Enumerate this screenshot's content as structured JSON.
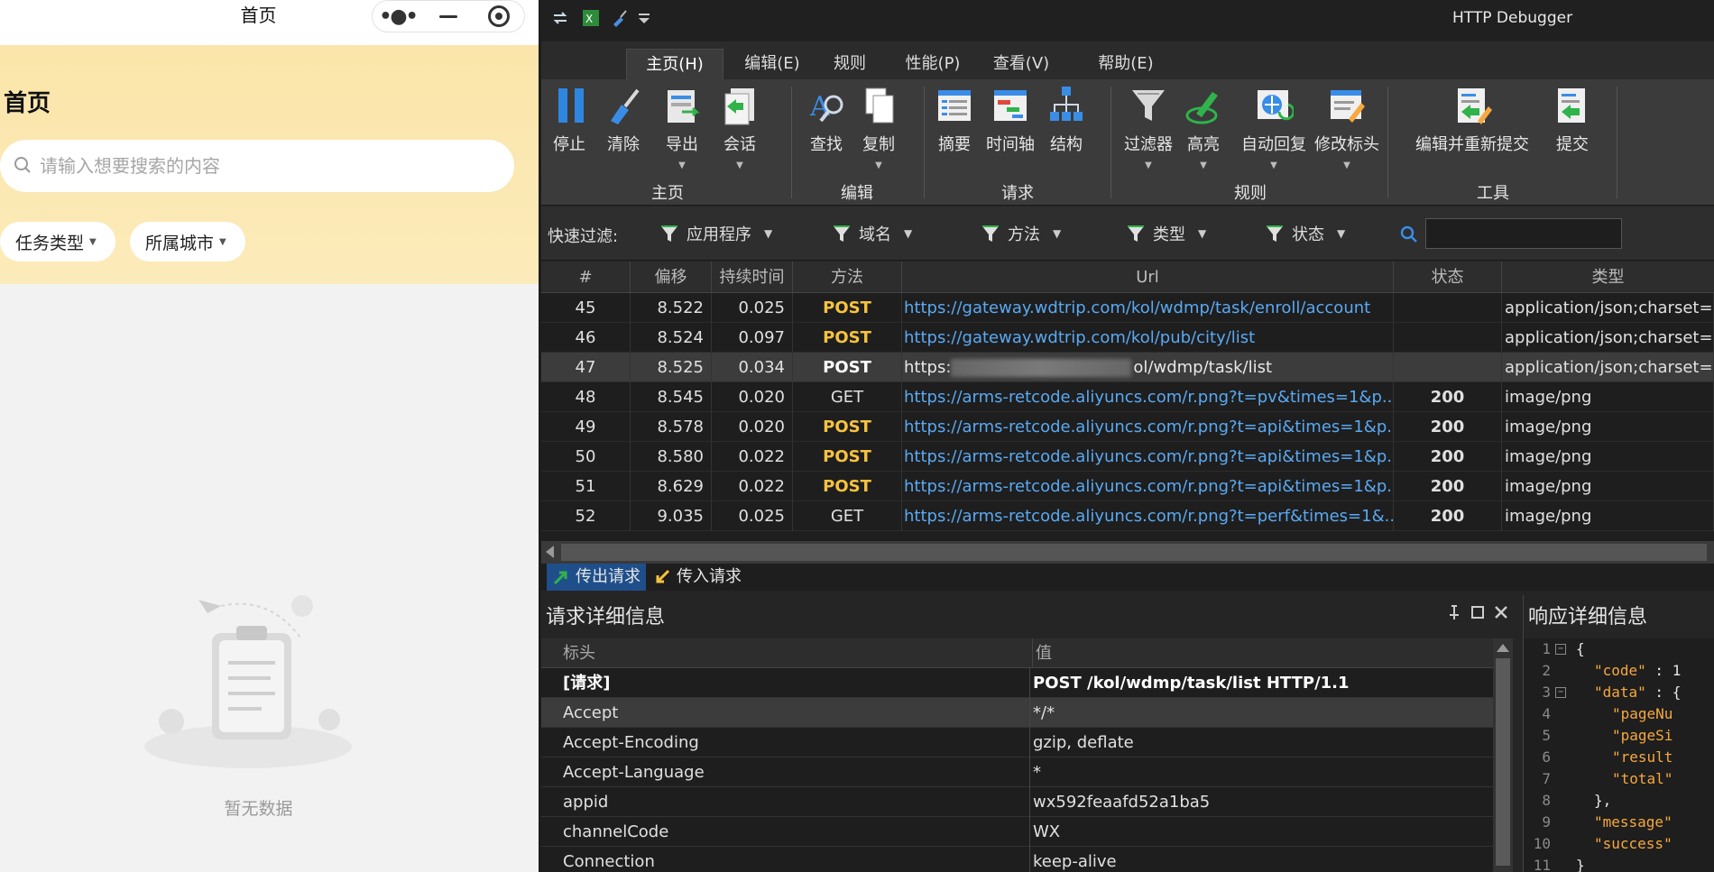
{
  "mini_program": {
    "nav_title": "首页",
    "page_title": "首页",
    "search": {
      "placeholder": "请输入想要搜索的内容"
    },
    "filters": [
      {
        "label": "任务类型"
      },
      {
        "label": "所属城市"
      }
    ],
    "empty_text": "暂无数据",
    "colors": {
      "header_gradient": "#fbe4a6",
      "background": "#f2f2f2"
    }
  },
  "debugger": {
    "window_title": "HTTP Debugger",
    "menu_tabs": [
      {
        "label": "主页(H)",
        "active": true
      },
      {
        "label": "编辑(E)"
      },
      {
        "label": "规则"
      },
      {
        "label": "性能(P)"
      },
      {
        "label": "查看(V)"
      },
      {
        "label": "帮助(E)"
      }
    ],
    "ribbon": {
      "buttons": [
        {
          "label": "停止",
          "icon": "pause-icon"
        },
        {
          "label": "清除",
          "icon": "broom-icon"
        },
        {
          "label": "导出",
          "icon": "export-icon",
          "dropdown": true
        },
        {
          "label": "会话",
          "icon": "session-icon",
          "dropdown": true
        },
        {
          "label": "查找",
          "icon": "find-icon"
        },
        {
          "label": "复制",
          "icon": "copy-icon",
          "dropdown": true
        },
        {
          "label": "摘要",
          "icon": "summary-icon"
        },
        {
          "label": "时间轴",
          "icon": "timeline-icon"
        },
        {
          "label": "结构",
          "icon": "structure-icon"
        },
        {
          "label": "过滤器",
          "icon": "filter-icon",
          "dropdown": true
        },
        {
          "label": "高亮",
          "icon": "highlight-icon",
          "dropdown": true
        },
        {
          "label": "自动回复",
          "icon": "auto-reply-icon",
          "dropdown": true
        },
        {
          "label": "修改标头",
          "icon": "modify-header-icon",
          "dropdown": true
        },
        {
          "label": "编辑并重新提交",
          "icon": "edit-resubmit-icon"
        },
        {
          "label": "提交",
          "icon": "submit-icon"
        }
      ],
      "groups": [
        "主页",
        "编辑",
        "请求",
        "规则",
        "工具"
      ]
    },
    "quick_filter": {
      "label": "快速过滤:",
      "items": [
        "应用程序",
        "域名",
        "方法",
        "类型",
        "状态"
      ]
    },
    "grid": {
      "columns": [
        "#",
        "偏移",
        "持续时间",
        "方法",
        "Url",
        "状态",
        "类型"
      ],
      "rows": [
        {
          "num": "45",
          "offset": "8.522",
          "duration": "0.025",
          "method": "POST",
          "url": "https://gateway.wdtrip.com/kol/wdmp/task/enroll/account",
          "status": "",
          "type": "application/json;charset=..."
        },
        {
          "num": "46",
          "offset": "8.524",
          "duration": "0.097",
          "method": "POST",
          "url": "https://gateway.wdtrip.com/kol/pub/city/list",
          "status": "",
          "type": "application/json;charset=..."
        },
        {
          "num": "47",
          "offset": "8.525",
          "duration": "0.034",
          "method": "POST",
          "url_prefix": "https:",
          "url_suffix": "ol/wdmp/task/list",
          "status": "",
          "type": "application/json;charset=..."
        },
        {
          "num": "48",
          "offset": "8.545",
          "duration": "0.020",
          "method": "GET",
          "url": "https://arms-retcode.aliyuncs.com/r.png?t=pv&times=1&p...",
          "status": "200",
          "type": "image/png"
        },
        {
          "num": "49",
          "offset": "8.578",
          "duration": "0.020",
          "method": "POST",
          "url": "https://arms-retcode.aliyuncs.com/r.png?t=api&times=1&p...",
          "status": "200",
          "type": "image/png"
        },
        {
          "num": "50",
          "offset": "8.580",
          "duration": "0.022",
          "method": "POST",
          "url": "https://arms-retcode.aliyuncs.com/r.png?t=api&times=1&p...",
          "status": "200",
          "type": "image/png"
        },
        {
          "num": "51",
          "offset": "8.629",
          "duration": "0.022",
          "method": "POST",
          "url": "https://arms-retcode.aliyuncs.com/r.png?t=api&times=1&p...",
          "status": "200",
          "type": "image/png"
        },
        {
          "num": "52",
          "offset": "9.035",
          "duration": "0.025",
          "method": "GET",
          "url": "https://arms-retcode.aliyuncs.com/r.png?t=perf&times=1&...",
          "status": "200",
          "type": "image/png"
        }
      ]
    },
    "direction_tabs": [
      {
        "label": "传出请求",
        "active": true
      },
      {
        "label": "传入请求"
      }
    ],
    "request_details": {
      "title": "请求详细信息",
      "columns": [
        "标头",
        "值"
      ],
      "rows": [
        {
          "key": "[请求]",
          "value": "POST /kol/wdmp/task/list HTTP/1.1"
        },
        {
          "key": "Accept",
          "value": "*/*"
        },
        {
          "key": "Accept-Encoding",
          "value": "gzip, deflate"
        },
        {
          "key": "Accept-Language",
          "value": "*"
        },
        {
          "key": "appid",
          "value": "wx592feaafd52a1ba5"
        },
        {
          "key": "channelCode",
          "value": "WX"
        },
        {
          "key": "Connection",
          "value": "keep-alive"
        }
      ]
    },
    "response_details": {
      "title": "响应详细信息",
      "lines": [
        {
          "n": "1",
          "text": "{"
        },
        {
          "n": "2",
          "key": "\"code\"",
          "rest": " : 1"
        },
        {
          "n": "3",
          "key": "\"data\"",
          "rest": " : {"
        },
        {
          "n": "4",
          "key": "\"pageNu",
          "rest": ""
        },
        {
          "n": "5",
          "key": "\"pageSi",
          "rest": ""
        },
        {
          "n": "6",
          "key": "\"result",
          "rest": ""
        },
        {
          "n": "7",
          "key": "\"total\"",
          "rest": ""
        },
        {
          "n": "8",
          "text": "},",
          "indent": true
        },
        {
          "n": "9",
          "key": "\"message\"",
          "rest": ""
        },
        {
          "n": "10",
          "key": "\"success\"",
          "rest": ""
        },
        {
          "n": "11",
          "text": "}"
        }
      ]
    },
    "colors": {
      "post": "#f7c23e",
      "url": "#5aa9f2",
      "active_tab": "#1f4f8a",
      "json_key": "#f7a83e"
    }
  }
}
